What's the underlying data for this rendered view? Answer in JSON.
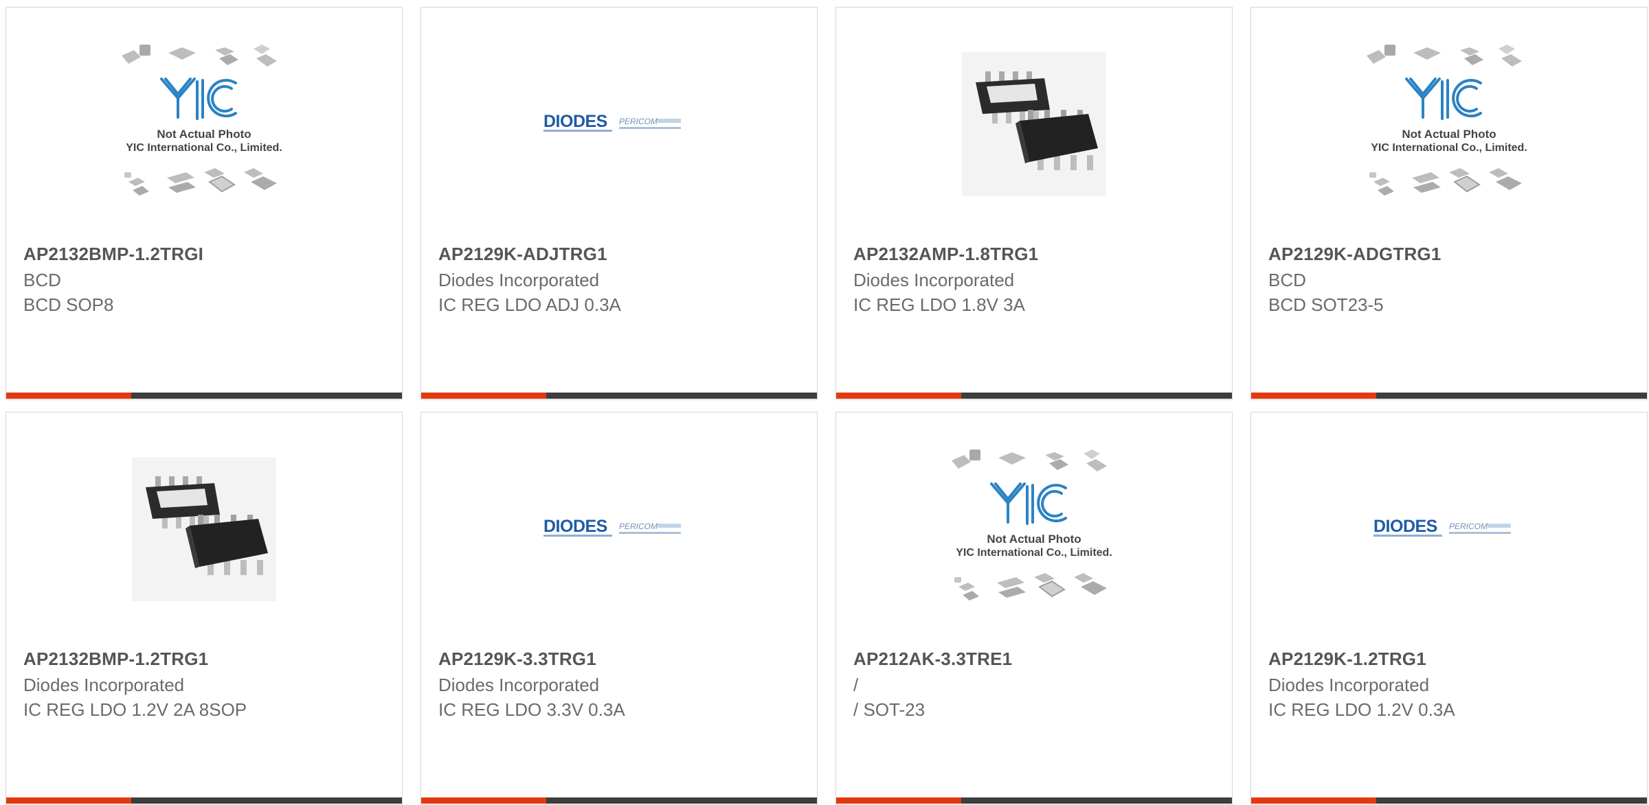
{
  "colors": {
    "accent": "#e23a0e",
    "bar": "#3d3d3d",
    "partNumber": "#555555",
    "text": "#6a6a6a",
    "diodesBlue": "#1f5aa6",
    "yicBlue": "#2a83c4"
  },
  "yic_placeholder": {
    "line1": "Not Actual Photo",
    "line2": "YIC International Co., Limited.",
    "logo": "YIC"
  },
  "diodes_logo": {
    "brand": "DIODES",
    "sub": "PERICOM"
  },
  "products": [
    {
      "part": "AP2132BMP-1.2TRGI",
      "manufacturer": "BCD",
      "description": "BCD SOP8",
      "image": "yic-placeholder"
    },
    {
      "part": "AP2129K-ADJTRG1",
      "manufacturer": "Diodes Incorporated",
      "description": "IC REG LDO ADJ 0.3A",
      "image": "diodes-logo"
    },
    {
      "part": "AP2132AMP-1.8TRG1",
      "manufacturer": "Diodes Incorporated",
      "description": "IC REG LDO 1.8V 3A",
      "image": "sop8-chip"
    },
    {
      "part": "AP2129K-ADGTRG1",
      "manufacturer": "BCD",
      "description": "BCD SOT23-5",
      "image": "yic-placeholder"
    },
    {
      "part": "AP2132BMP-1.2TRG1",
      "manufacturer": "Diodes Incorporated",
      "description": "IC REG LDO 1.2V 2A 8SOP",
      "image": "sop8-chip"
    },
    {
      "part": "AP2129K-3.3TRG1",
      "manufacturer": "Diodes Incorporated",
      "description": "IC REG LDO 3.3V 0.3A",
      "image": "diodes-logo"
    },
    {
      "part": "AP212AK-3.3TRE1",
      "manufacturer": "/",
      "description": "/ SOT-23",
      "image": "yic-placeholder"
    },
    {
      "part": "AP2129K-1.2TRG1",
      "manufacturer": "Diodes Incorporated",
      "description": "IC REG LDO 1.2V 0.3A",
      "image": "diodes-logo"
    }
  ]
}
